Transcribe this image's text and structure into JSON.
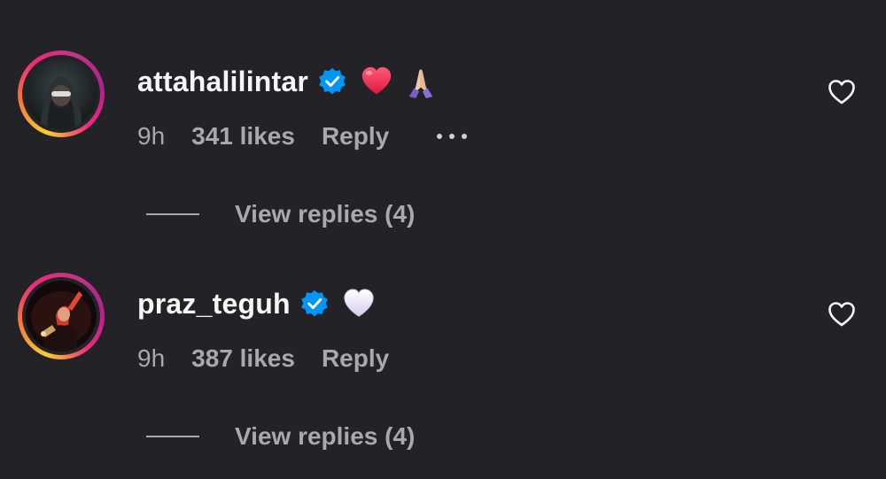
{
  "comments": [
    {
      "username": "attahalilintar",
      "verified": true,
      "emojis": [
        "red-heart",
        "folded-hands"
      ],
      "time": "9h",
      "likes": "341 likes",
      "reply": "Reply",
      "view_replies": "View replies (4)"
    },
    {
      "username": "praz_teguh",
      "verified": true,
      "emojis": [
        "white-heart"
      ],
      "time": "9h",
      "likes": "387 likes",
      "reply": "Reply",
      "view_replies": "View replies (4)"
    }
  ],
  "icons": {
    "verified": "verified-badge-icon",
    "like": "heart-outline-icon",
    "more": "more-options-icon"
  },
  "colors": {
    "background": "#222227",
    "text_primary": "#f5f5f5",
    "text_secondary": "#a8a8ad",
    "verified_blue": "#0095f6"
  }
}
